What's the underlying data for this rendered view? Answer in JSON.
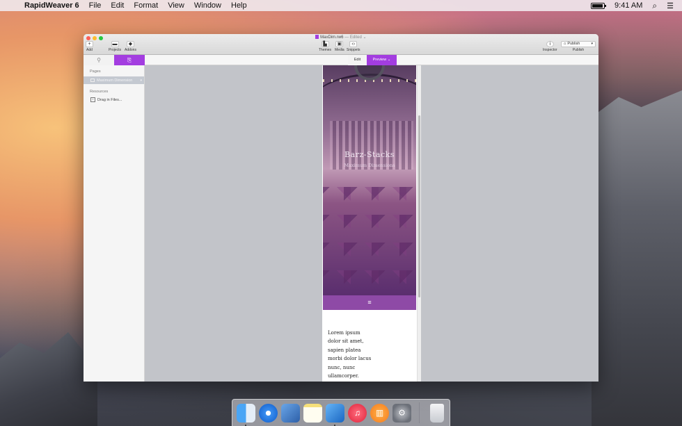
{
  "menubar": {
    "apple_glyph": "",
    "items": [
      "RapidWeaver 6",
      "File",
      "Edit",
      "Format",
      "View",
      "Window",
      "Help"
    ],
    "clock": "9:41 AM",
    "search_glyph": "⌕",
    "list_glyph": "☰"
  },
  "window": {
    "doc_name": "MaxDim.rw6",
    "doc_status": "— Edited ⌄",
    "toolbar": {
      "add_glyph": "+",
      "add": "Add",
      "projects": "Projects",
      "addons": "Addons",
      "themes": "Themes",
      "media": "Media",
      "snippets": "Snippets",
      "inspector_glyph": "i",
      "inspector": "Inspector",
      "publish_button": "Publish",
      "publish": "Publish"
    },
    "tabs": {
      "tools_glyph": "⚲",
      "pages_glyph": "⎘",
      "edit": "Edit",
      "preview": "Preview ⌄"
    }
  },
  "sidebar": {
    "pages_heading": "Pages",
    "page_item": "Maximum Dimension",
    "resources_heading": "Resources",
    "resources_item": "Drag in Files..."
  },
  "preview": {
    "site_title": "Barz-Stacks",
    "site_subtitle": "Maximum Dimensions",
    "menu_glyph": "≡",
    "body_lines": [
      "Lorem ipsum",
      "dolor sit amet,",
      "sapien platea",
      "morbi dolor lacus",
      "nunc, nunc",
      "ullamcorper."
    ]
  },
  "dock": {
    "apps": [
      "Finder",
      "Safari",
      "Preview",
      "Notes",
      "Xcode",
      "iTunes",
      "iBooks",
      "System Preferences",
      "Trash"
    ]
  },
  "colors": {
    "accent": "#a33de0",
    "nav_bar": "#8e4aa6"
  }
}
